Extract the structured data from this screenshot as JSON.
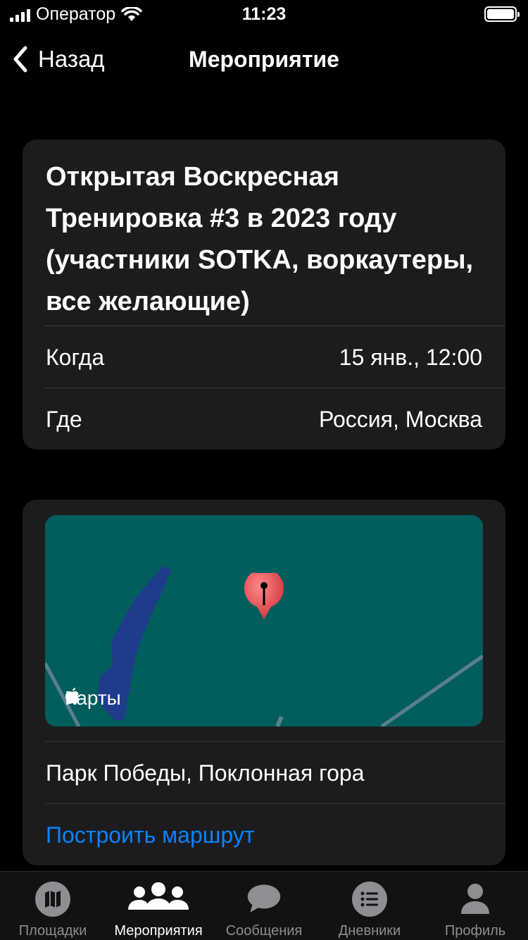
{
  "status_bar": {
    "carrier": "Оператор",
    "time": "11:23"
  },
  "nav": {
    "back_label": "Назад",
    "title": "Мероприятие"
  },
  "event": {
    "title": "Открытая Воскресная Тренировка  #3 в 2023 году (участники SOTKA, воркаутеры, все желающие)",
    "when_label": "Когда",
    "when_value": "15 янв., 12:00",
    "where_label": "Где",
    "where_value": "Россия, Москва"
  },
  "location": {
    "map_logo": "Карты",
    "address": "Парк Победы, Поклонная гора",
    "route_label": "Построить маршрут"
  },
  "tab_bar": {
    "items": [
      {
        "label": "Площадки",
        "icon": "map-icon"
      },
      {
        "label": "Мероприятия",
        "icon": "people-icon"
      },
      {
        "label": "Сообщения",
        "icon": "chat-bubble-icon"
      },
      {
        "label": "Дневники",
        "icon": "list-icon"
      },
      {
        "label": "Профиль",
        "icon": "person-icon"
      }
    ],
    "active_index": 1
  },
  "colors": {
    "background": "#000000",
    "card": "#1c1c1e",
    "accent": "#0a84ff",
    "map_water": "#025e5d",
    "map_land": "#1f3c8a",
    "pin": "#e8474b",
    "tab_inactive": "#8e8e93"
  }
}
